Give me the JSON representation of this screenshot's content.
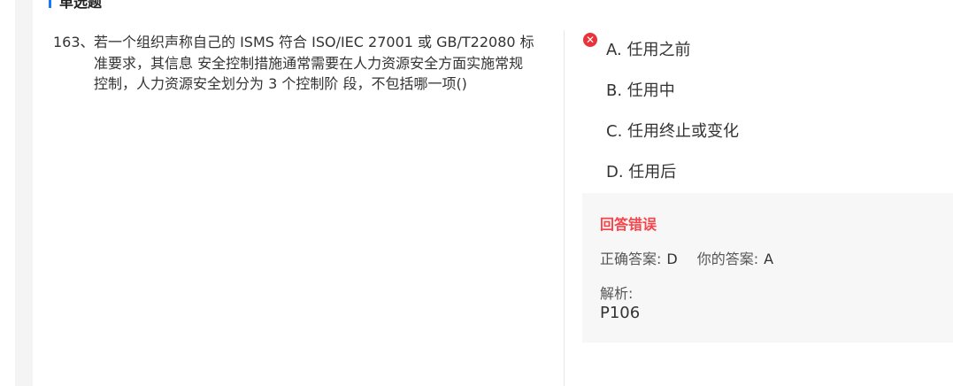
{
  "section": {
    "title": "单选题"
  },
  "question": {
    "number": "163、",
    "text": "若一个组织声称自己的 ISMS 符合 ISO/IEC 27001 或 GB/T22080 标准要求，其信息 安全控制措施通常需要在人力资源安全方面实施常规控制，人力资源安全划分为 3 个控制阶 段，不包括哪一项()"
  },
  "options": [
    {
      "label": "A. 任用之前",
      "status": "wrong-selected"
    },
    {
      "label": "B. 任用中",
      "status": "none"
    },
    {
      "label": "C. 任用终止或变化",
      "status": "none"
    },
    {
      "label": "D. 任用后",
      "status": "none"
    }
  ],
  "result": {
    "status": "回答错误",
    "correct_label": "正确答案:",
    "correct_value": "D",
    "yours_label": "你的答案:",
    "yours_value": "A",
    "analysis_label": "解析:",
    "analysis_text": "P106"
  },
  "colors": {
    "accent": "#1677ff",
    "error": "#f5454b",
    "error_icon": "#e8333a"
  },
  "icons": {
    "wrong": "close-circle-icon"
  }
}
